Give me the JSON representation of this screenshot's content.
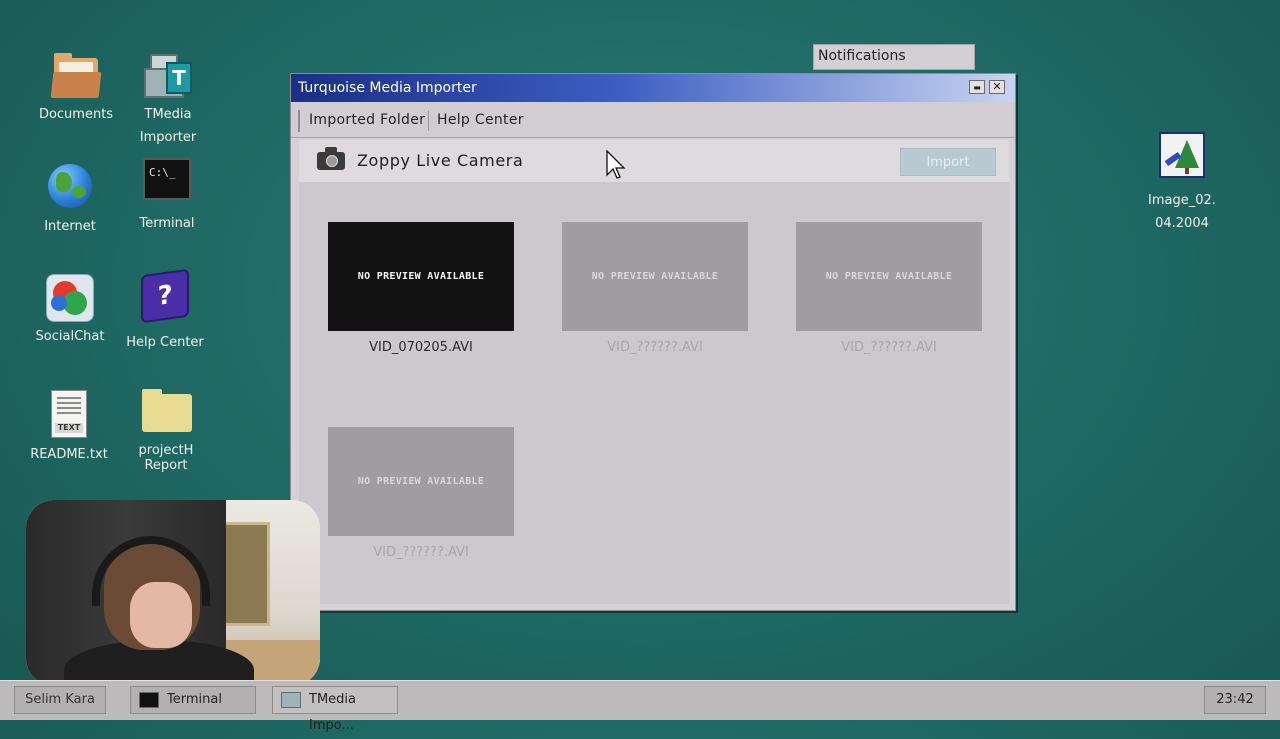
{
  "desktop": {
    "icons": [
      {
        "label": "Documents"
      },
      {
        "label": "TMedia\nImporter",
        "line1": "TMedia",
        "line2": "Importer"
      },
      {
        "label": "Internet"
      },
      {
        "label": "Terminal",
        "glyph_text": "C:\\_"
      },
      {
        "label": "SocialChat"
      },
      {
        "label": "Help Center",
        "glyph_text": "?"
      },
      {
        "label": "README.txt",
        "glyph_text": "TEXT"
      },
      {
        "label": "projectH Report",
        "line1": "projectH",
        "line2": "Report"
      },
      {
        "label": "Image_02.04.2004",
        "line1": "Image_02.",
        "line2": "04.2004"
      }
    ]
  },
  "notifications": {
    "label": "Notifications"
  },
  "window": {
    "title": "Turquoise Media Importer",
    "minimize_glyph": "▬",
    "close_glyph": "✕",
    "menu": {
      "imported_folder": "Imported Folder",
      "help_center": "Help Center"
    },
    "device": {
      "name": "Zoppy Live Camera",
      "import_label": "Import"
    },
    "files": [
      {
        "preview": "NO PREVIEW AVAILABLE",
        "name": "VID_070205.AVI",
        "state": "active"
      },
      {
        "preview": "NO PREVIEW AVAILABLE",
        "name": "VID_??????.AVI",
        "state": "dim"
      },
      {
        "preview": "NO PREVIEW AVAILABLE",
        "name": "VID_??????.AVI",
        "state": "dim"
      },
      {
        "preview": "NO PREVIEW AVAILABLE",
        "name": "VID_??????.AVI",
        "state": "dim"
      }
    ]
  },
  "taskbar": {
    "user": "Selim Kara",
    "items": [
      {
        "label": "Terminal"
      },
      {
        "label": "TMedia Impo..."
      }
    ],
    "clock": "23:42"
  },
  "colors": {
    "desktop_bg": "#1f6b66",
    "titlebar_start": "#1a2f86",
    "titlebar_end": "#c8d4f0",
    "window_bg": "#d6d1d6",
    "import_button": "#b9c9d2"
  }
}
